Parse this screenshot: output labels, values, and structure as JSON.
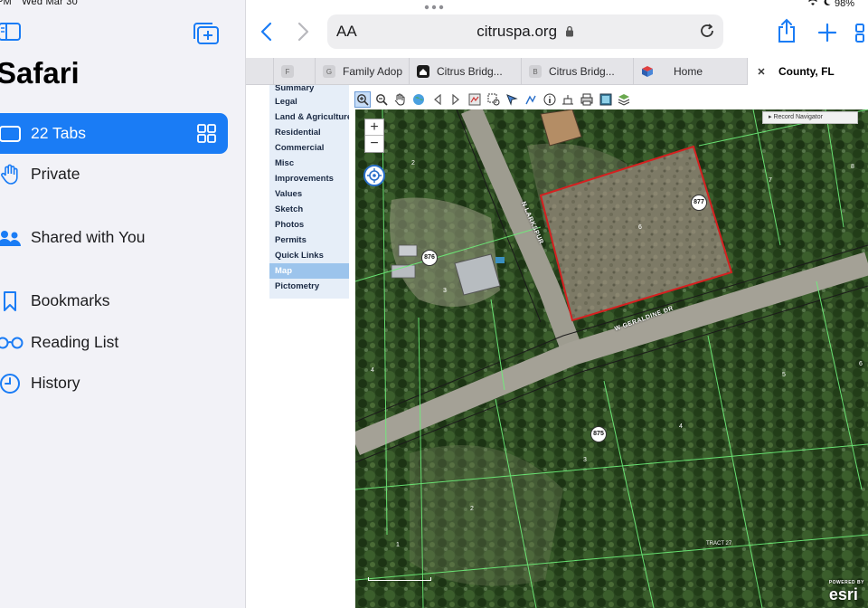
{
  "status": {
    "time": "PM",
    "date": "Wed Mar 30",
    "battery": "98%"
  },
  "sidebar": {
    "title": "Safari",
    "items": [
      {
        "label": "22 Tabs",
        "icon": "tabs-icon",
        "active": true
      },
      {
        "label": "Private",
        "icon": "hand-icon"
      },
      {
        "label": "Shared with You",
        "icon": "shared-people-icon"
      },
      {
        "label": "Bookmarks",
        "icon": "bookmark-icon"
      },
      {
        "label": "Reading List",
        "icon": "glasses-icon"
      },
      {
        "label": "History",
        "icon": "clock-icon"
      }
    ]
  },
  "address_bar": {
    "aa": "AA",
    "url": "citruspa.org"
  },
  "tabs": [
    {
      "label": "F"
    },
    {
      "label": "Family Adop"
    },
    {
      "label": "Citrus Bridg..."
    },
    {
      "label": "Citrus Bridg..."
    },
    {
      "label": "Home"
    },
    {
      "label": "County, FL"
    }
  ],
  "page": {
    "nav": [
      "Summary",
      "Legal",
      "Land & Agriculture",
      "Residential",
      "Commercial",
      "Misc",
      "Improvements",
      "Values",
      "Sketch",
      "Photos",
      "Permits",
      "Quick Links",
      "Map",
      "Pictometry"
    ],
    "selected_nav": "Map",
    "record_navigator": "Record Navigator",
    "zoom_in": "+",
    "zoom_out": "−",
    "map_labels": {
      "street_a": "N LARKSPUR",
      "street_b": "W GERALDINE DR",
      "house_876": "876",
      "house_877": "877",
      "house_875": "875",
      "lot_2": "2",
      "lot_3": "3",
      "lot_4": "4",
      "lot_5": "5",
      "lot_6": "6",
      "lot_7": "7",
      "lot_8": "8",
      "lot_1": "1",
      "tract": "TRACT 27"
    },
    "esri": {
      "powered": "POWERED BY",
      "brand": "esri"
    }
  },
  "colors": {
    "accent": "#1a7cf5",
    "parcel_outline": "#d42020"
  }
}
